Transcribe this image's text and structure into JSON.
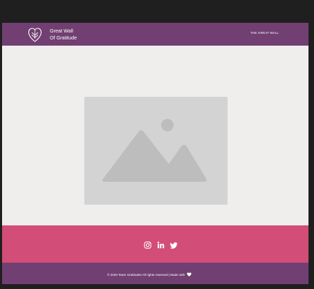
{
  "header": {
    "brand_line1": "Great Wall",
    "brand_line2": "Of Gratitude",
    "nav_label": "THE GREAT WALL"
  },
  "main": {
    "image_placeholder": "image-placeholder-icon"
  },
  "social": {
    "icons": [
      "instagram-icon",
      "linkedin-icon",
      "twitter-icon"
    ]
  },
  "footer": {
    "copyright": "© 2020 Team Gratitudes All rights reserved | Made with",
    "heart_icon": "heart-icon"
  },
  "colors": {
    "header_bg": "#713f72",
    "social_band_bg": "#d24d77",
    "footer_bg": "#713f72",
    "content_bg": "#f0eded",
    "placeholder_bg": "#d3d3d3"
  }
}
